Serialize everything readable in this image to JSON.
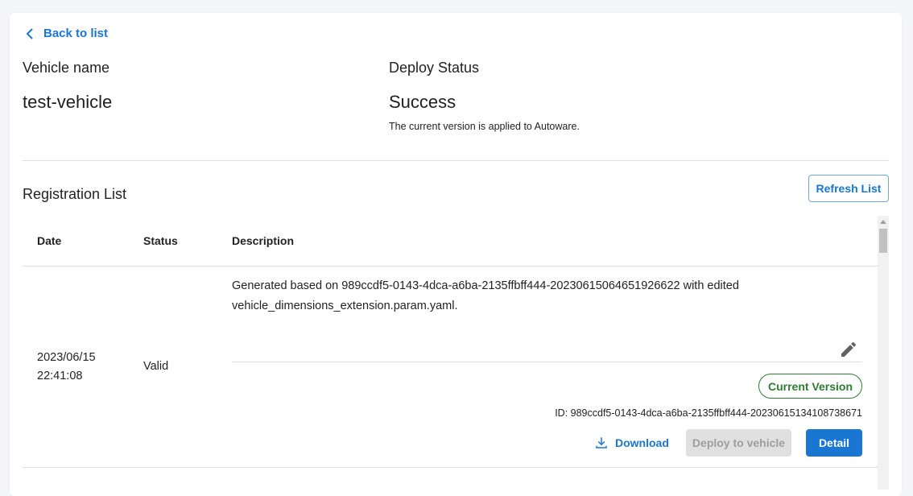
{
  "nav": {
    "back_label": "Back to list"
  },
  "vehicle": {
    "name_label": "Vehicle name",
    "name_value": "test-vehicle"
  },
  "deploy": {
    "status_label": "Deploy Status",
    "status_value": "Success",
    "status_message": "The current version is applied to Autoware."
  },
  "registration": {
    "title": "Registration List",
    "refresh_label": "Refresh List",
    "columns": [
      "Date",
      "Status",
      "Description"
    ],
    "rows": [
      {
        "date": "2023/06/15",
        "time": "22:41:08",
        "status": "Valid",
        "description_line1": "Generated based on 989ccdf5-0143-4dca-a6ba-2135ffbff444-20230615064651926622 with edited",
        "description_line2": "vehicle_dimensions_extension.param.yaml.",
        "badge": "Current Version",
        "id_text": "ID: 989ccdf5-0143-4dca-a6ba-2135ffbff444-20230615134108738671",
        "download_label": "Download",
        "deploy_label": "Deploy to vehicle",
        "detail_label": "Detail"
      }
    ]
  },
  "colors": {
    "accent": "#1976d2",
    "success": "#2e7d32",
    "disabled": "#e0e0e0"
  },
  "icons": [
    "chevron-left-icon",
    "pencil-icon",
    "download-icon"
  ]
}
